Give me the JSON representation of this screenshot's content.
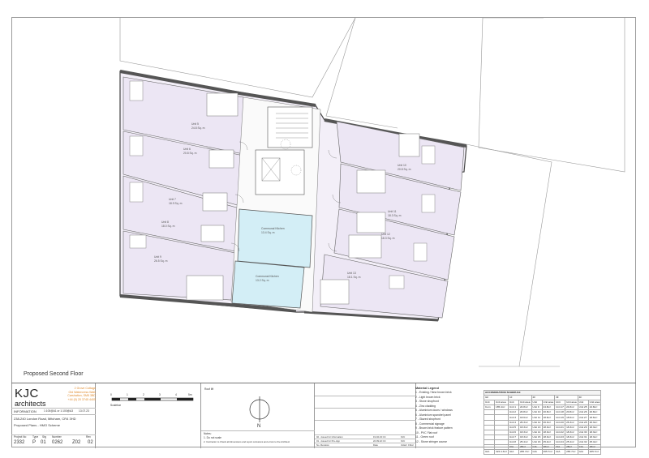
{
  "plan": {
    "title": "Proposed Second Floor",
    "rooms": [
      {
        "label_line1": "Unit 5",
        "label_line2": "24.8 Sq. m"
      },
      {
        "label_line1": "Unit 6",
        "label_line2": "20.8 Sq. m"
      },
      {
        "label_line1": "Unit 7",
        "label_line2": "18.9 Sq. m"
      },
      {
        "label_line1": "Unit 8",
        "label_line2": "18.0 Sq. m"
      },
      {
        "label_line1": "Unit 9",
        "label_line2": "26.5 Sq. m"
      },
      {
        "label_line1": "Unit 10",
        "label_line2": "20.8 Sq. m"
      },
      {
        "label_line1": "Unit 11",
        "label_line2": "18.3 Sq. m"
      },
      {
        "label_line1": "Unit 12",
        "label_line2": "18.3 Sq. m"
      },
      {
        "label_line1": "Unit 13",
        "label_line2": "18.1 Sq. m"
      },
      {
        "label_line1": "Communal Kitchen",
        "label_line2": "13.4 Sq. m"
      },
      {
        "label_line1": "Communal Kitchen",
        "label_line2": "13.2 Sq. m"
      }
    ]
  },
  "title_block": {
    "logo": "KJC",
    "logo_sub": "architects",
    "office": [
      "2 Grove Cottage",
      "Old Watercress Walk",
      "Carshalton, SM5 3BD",
      "+44 (0) 20 3745 4405"
    ],
    "information_label": "INFORMATION",
    "scales": "1:100@A1 or 1:100@A3",
    "date": "13.07.23",
    "address": "238-240 London Road, Mitcham, CR4 3HD",
    "drawing_title": "Proposed Plans - HMO Scheme",
    "ref_headers": [
      "Project No",
      "Type",
      "Stg",
      "Number",
      "Rev"
    ],
    "ref_values": [
      "2332",
      "P",
      "01",
      "0262",
      "Z02",
      "02"
    ],
    "scalebar_label": "Scalebar",
    "scalebar_ticks": [
      "0",
      "1",
      "2",
      "3",
      "4",
      "5m"
    ],
    "north_label": "N",
    "roof_label": "Roof lift",
    "notes_title": "Notes:",
    "notes": [
      "1. Do not scale",
      "2. Contractor to Check all dimensions and report omissions and errors to the Architect"
    ],
    "revisions": [
      {
        "rev": "02 - Issued for Information",
        "date": "19.02.23 CC",
        "by": "KJC"
      },
      {
        "rev": "01 - Issued for Pre-App",
        "date": "22.09.22 CC",
        "by": "KJC"
      },
      {
        "rev": "No. Revision",
        "date": "Date",
        "by": "Initial / Chkd"
      }
    ]
  },
  "material_legend": {
    "title": "Material Legend",
    "items": [
      "1 - Existing / New brown brick",
      "2 - Light brown brick",
      "3 - Stone shopfront",
      "4 - Zinc cladding",
      "5 - Aluminium doors / windows",
      "6 - Aluminium spandrel panel",
      "7 - Glazed shopfront",
      "8 - Commercial signage",
      "9 - Brown brick feature pattern",
      "10 - PVC Flat roof",
      "11 - Green roof",
      "12 - Stone stringer course"
    ]
  },
  "schedule": {
    "title": "ACCOMODATION SCHEDULE",
    "floors": [
      "GF",
      "1F",
      "2F",
      "3F",
      "4F"
    ],
    "col_headers": [
      "Unit",
      "Unit area",
      "Unit",
      "Unit area",
      "Unit",
      "Unit area",
      "Unit",
      "Unit area",
      "Unit",
      "Unit area"
    ],
    "rows": [
      [
        "Com",
        "185.4m²",
        "Unit 1",
        "24.8m²",
        "Unit 9",
        "24.8m²",
        "Unit 17",
        "24.8m²",
        "Unit 25",
        "24.8m²"
      ],
      [
        "",
        "",
        "Unit 2",
        "20.8m²",
        "Unit 10",
        "20.8m²",
        "Unit 18",
        "20.8m²",
        "Unit 26",
        "20.8m²"
      ],
      [
        "",
        "",
        "Unit 3",
        "18.6m²",
        "Unit 11",
        "18.6m²",
        "Unit 19",
        "18.6m²",
        "Unit 27",
        "18.6m²"
      ],
      [
        "",
        "",
        "Unit 4",
        "26.3m²",
        "Unit 12",
        "26.3m²",
        "Unit 20",
        "26.3m²",
        "Unit 28",
        "26.3m²"
      ],
      [
        "",
        "",
        "Unit 5",
        "18.3m²",
        "Unit 13",
        "18.3m²",
        "Unit 21",
        "18.3m²",
        "Unit 29",
        "18.3m²"
      ],
      [
        "",
        "",
        "Unit 6",
        "18.3m²",
        "Unit 14",
        "18.3m²",
        "Unit 22",
        "18.3m²",
        "Unit 30",
        "18.3m²"
      ],
      [
        "",
        "",
        "Unit 7",
        "18.3m²",
        "Unit 15",
        "18.3m²",
        "Unit 23",
        "18.3m²",
        "Unit 31",
        "18.3m²"
      ],
      [
        "",
        "",
        "Unit 8",
        "25.4m²",
        "Unit 16",
        "25.4m²",
        "Unit 24",
        "25.4m²",
        "Unit 32",
        "25.4m²"
      ],
      [
        "",
        "",
        "CIA",
        "28m²",
        "CIA",
        "28m²",
        "CIA",
        "28m²",
        "CIA",
        "28m²"
      ],
      [
        "GIA",
        "322.4.3m²",
        "GIA",
        "265.7m²",
        "GIA",
        "265.7m²",
        "GIA",
        "265.7m²",
        "GIA",
        "265.7m²"
      ]
    ]
  }
}
